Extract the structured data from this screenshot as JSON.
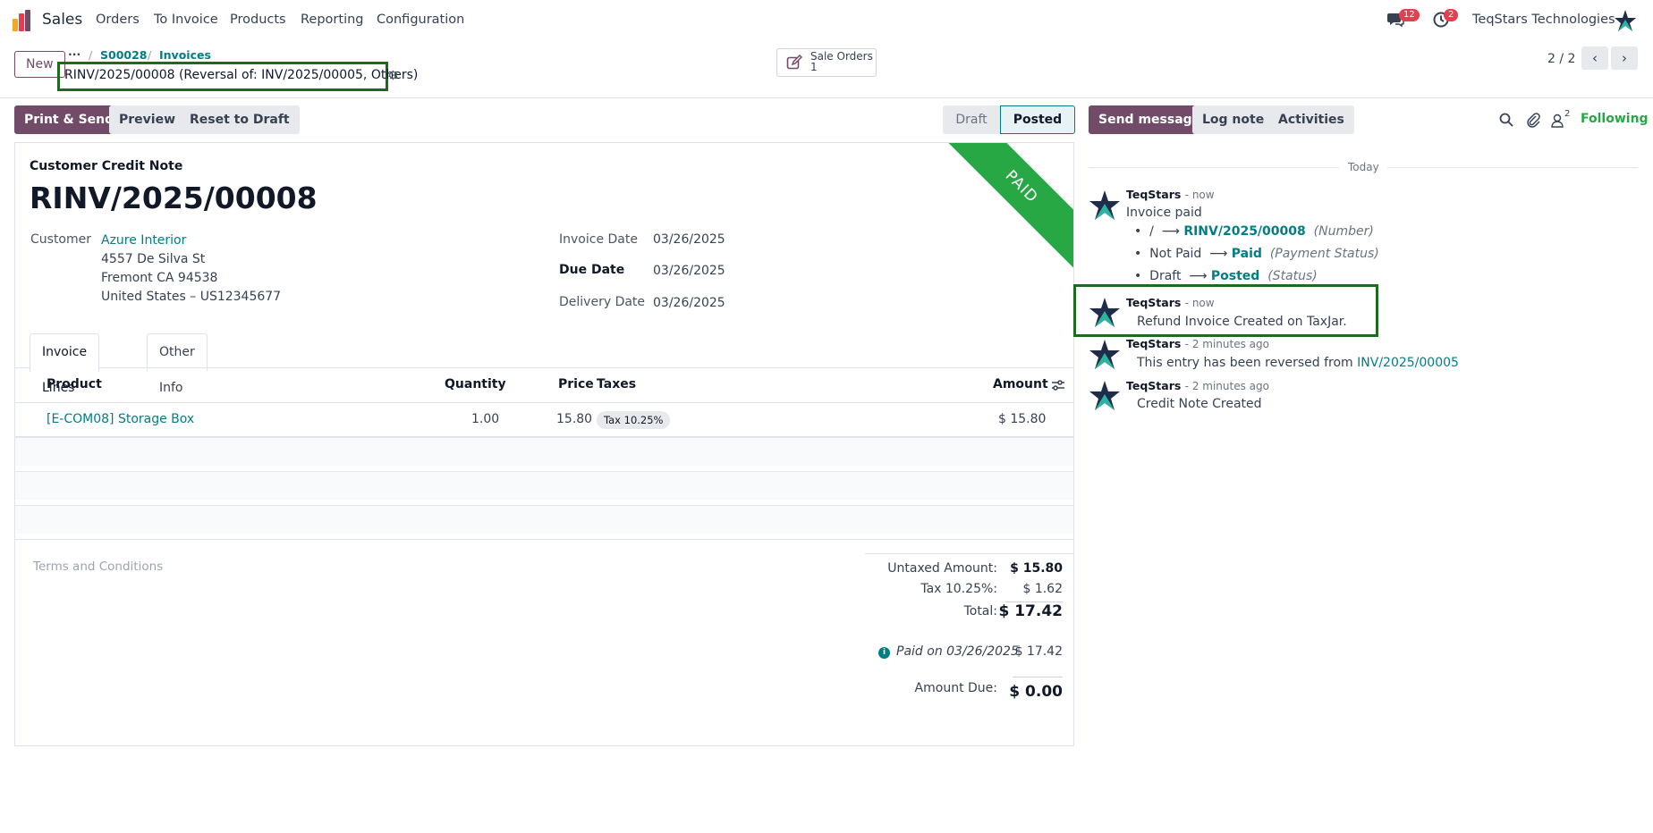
{
  "navbar": {
    "app_name": "Sales",
    "menu": [
      "Orders",
      "To Invoice",
      "Products",
      "Reporting",
      "Configuration"
    ],
    "messages_count": "12",
    "activities_count": "2",
    "company": "TeqStars Technologies",
    "icons": [
      "app-logo-icon",
      "chat-icon",
      "clock-icon",
      "star-logo-icon"
    ]
  },
  "control_panel": {
    "new_label": "New",
    "breadcrumb": [
      "S00028",
      "Invoices"
    ],
    "record_title": "RINV/2025/00008 (Reversal of: INV/2025/00005, Others)",
    "smart_button": {
      "label": "Sale Orders",
      "count": "1"
    },
    "pager": "2 / 2"
  },
  "actions": {
    "print_send": "Print & Send",
    "preview": "Preview",
    "reset": "Reset to Draft",
    "status": [
      "Draft",
      "Posted"
    ]
  },
  "chatter_actions": {
    "send_message": "Send message",
    "log_note": "Log note",
    "activities": "Activities",
    "followers_count": "2",
    "following": "Following"
  },
  "form": {
    "ribbon": "PAID",
    "doc_type": "Customer Credit Note",
    "number": "RINV/2025/00008",
    "customer_label": "Customer",
    "customer_name": "Azure Interior",
    "address": [
      "4557 De Silva St",
      "Fremont CA 94538",
      "United States – US12345677"
    ],
    "invoice_date_label": "Invoice Date",
    "invoice_date": "03/26/2025",
    "due_date_label": "Due Date",
    "due_date": "03/26/2025",
    "delivery_date_label": "Delivery Date",
    "delivery_date": "03/26/2025",
    "tabs": [
      "Invoice Lines",
      "Other Info"
    ],
    "columns": [
      "Product",
      "Quantity",
      "Price",
      "Taxes",
      "Amount"
    ],
    "lines": [
      {
        "product": "[E-COM08] Storage Box",
        "quantity": "1.00",
        "price": "15.80",
        "tax": "Tax 10.25%",
        "amount": "$ 15.80"
      }
    ],
    "terms_placeholder": "Terms and Conditions",
    "totals": {
      "untaxed_label": "Untaxed Amount:",
      "untaxed": "$ 15.80",
      "tax_label": "Tax 10.25%:",
      "tax": "$ 1.62",
      "total_label": "Total:",
      "total": "$ 17.42",
      "paid_label": "Paid on 03/26/2025",
      "paid": "$ 17.42",
      "due_label": "Amount Due:",
      "due": "$ 0.00"
    }
  },
  "chatter": {
    "day": "Today",
    "messages": [
      {
        "author": "TeqStars",
        "time": "- now",
        "body": "Invoice paid",
        "tracking": [
          {
            "old": "/",
            "new": "RINV/2025/00008",
            "field": "(Number)"
          },
          {
            "old": "Not Paid",
            "new": "Paid",
            "field": "(Payment Status)"
          },
          {
            "old": "Draft",
            "new": "Posted",
            "field": "(Status)"
          }
        ]
      },
      {
        "author": "TeqStars",
        "time": "- now",
        "body": "Refund Invoice Created on TaxJar."
      },
      {
        "author": "TeqStars",
        "time": "- 2 minutes ago",
        "body": "This entry has been reversed from ",
        "link": "INV/2025/00005"
      },
      {
        "author": "TeqStars",
        "time": "- 2 minutes ago",
        "body": "Credit Note Created"
      }
    ]
  }
}
